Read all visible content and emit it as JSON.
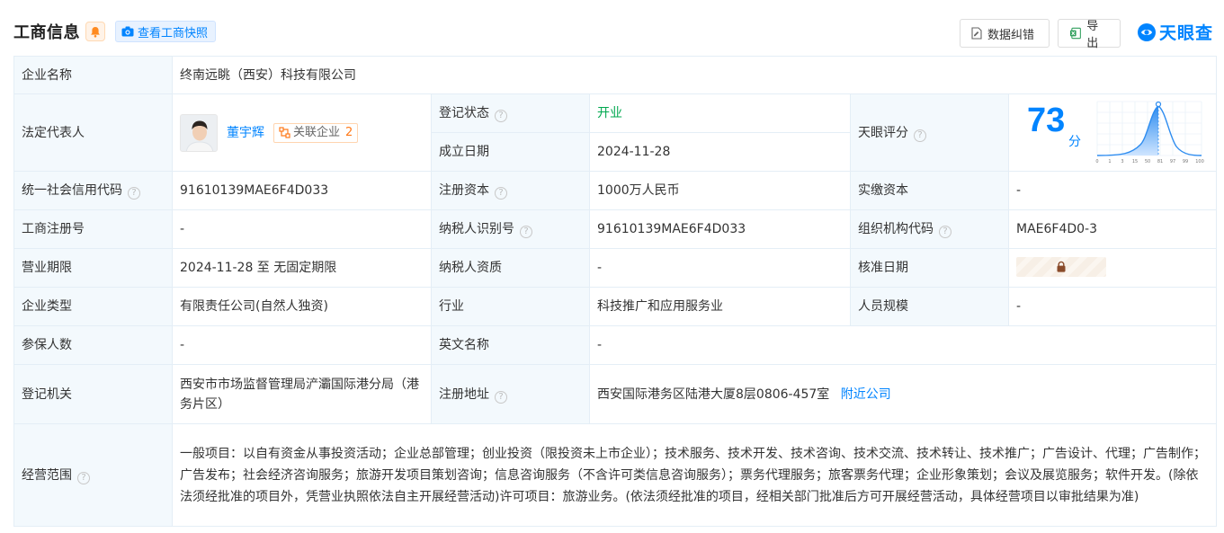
{
  "header": {
    "title": "工商信息",
    "snapshot_label": "查看工商快照",
    "correct_label": "数据纠错",
    "export_label": "导出",
    "logo_text": "天眼查"
  },
  "rows": {
    "company_name": {
      "label": "企业名称",
      "value": "终南远眺（西安）科技有限公司"
    },
    "legal_rep": {
      "label": "法定代表人",
      "name": "董宇辉",
      "assoc_label": "关联企业",
      "assoc_count": "2"
    },
    "reg_status": {
      "label": "登记状态",
      "value": "开业"
    },
    "found_date": {
      "label": "成立日期",
      "value": "2024-11-28"
    },
    "tianyan_score": {
      "label": "天眼评分",
      "value": "73",
      "unit": "分",
      "axis_ticks": [
        "0",
        "1",
        "3",
        "15",
        "50",
        "81",
        "97",
        "99",
        "100"
      ]
    },
    "credit_code": {
      "label": "统一社会信用代码",
      "value": "91610139MAE6F4D033"
    },
    "reg_capital": {
      "label": "注册资本",
      "value": "1000万人民币"
    },
    "paid_capital": {
      "label": "实缴资本",
      "value": "-"
    },
    "reg_no": {
      "label": "工商注册号",
      "value": "-"
    },
    "taxpayer_id": {
      "label": "纳税人识别号",
      "value": "91610139MAE6F4D033"
    },
    "org_code": {
      "label": "组织机构代码",
      "value": "MAE6F4D0-3"
    },
    "business_term": {
      "label": "营业期限",
      "value": "2024-11-28 至 无固定期限"
    },
    "taxpayer_qual": {
      "label": "纳税人资质",
      "value": "-"
    },
    "approval_date": {
      "label": "核准日期"
    },
    "company_type": {
      "label": "企业类型",
      "value": "有限责任公司(自然人独资)"
    },
    "industry": {
      "label": "行业",
      "value": "科技推广和应用服务业"
    },
    "staff_size": {
      "label": "人员规模",
      "value": "-"
    },
    "insured": {
      "label": "参保人数",
      "value": "-"
    },
    "english_name": {
      "label": "英文名称",
      "value": "-"
    },
    "reg_authority": {
      "label": "登记机关",
      "value": "西安市市场监督管理局浐灞国际港分局（港务片区）"
    },
    "reg_address": {
      "label": "注册地址",
      "value": "西安国际港务区陆港大厦8层0806-457室",
      "nearby_label": "附近公司"
    },
    "business_scope": {
      "label": "经营范围",
      "value": "一般项目：以自有资金从事投资活动；企业总部管理；创业投资（限投资未上市企业）；技术服务、技术开发、技术咨询、技术交流、技术转让、技术推广；广告设计、代理；广告制作；广告发布；社会经济咨询服务；旅游开发项目策划咨询；信息咨询服务（不含许可类信息咨询服务）；票务代理服务；旅客票务代理；企业形象策划；会议及展览服务；软件开发。(除依法须经批准的项目外，凭营业执照依法自主开展经营活动)许可项目：旅游业务。(依法须经批准的项目，经相关部门批准后方可开展经营活动，具体经营项目以审批结果为准)"
    }
  },
  "colors": {
    "accent": "#0084ff",
    "status_green": "#00a84f",
    "label_bg": "#f3f9fd"
  }
}
